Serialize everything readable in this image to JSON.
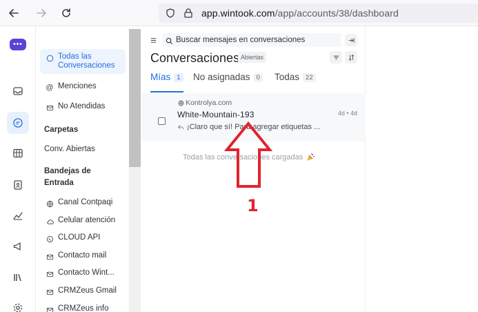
{
  "browser": {
    "url_domain": "app.wintook.com",
    "url_path": "/app/accounts/38/dashboard"
  },
  "rail": {
    "logo_glyph": "•••",
    "icons": [
      "inbox-icon",
      "chat-icon",
      "contacts-icon",
      "address-book-icon",
      "reports-icon",
      "campaigns-icon",
      "library-icon",
      "settings-icon"
    ]
  },
  "sidebar": {
    "items": [
      {
        "label": "Todas las Conversaciones",
        "icon": "chat-icon",
        "active": true
      },
      {
        "label": "Menciones",
        "icon": "at-icon"
      },
      {
        "label": "No Atendidas",
        "icon": "mail-icon"
      }
    ],
    "folders_heading": "Carpetas",
    "folders": [
      {
        "label": "Conv. Abiertas"
      }
    ],
    "inboxes_heading": "Bandejas de Entrada",
    "inboxes": [
      {
        "label": "Canal Contpaqi",
        "icon": "globe-icon"
      },
      {
        "label": "Celular atención",
        "icon": "cloud-icon"
      },
      {
        "label": "CLOUD API",
        "icon": "whatsapp-icon"
      },
      {
        "label": "Contacto mail",
        "icon": "mail-icon"
      },
      {
        "label": "Contacto Wint...",
        "icon": "mail-icon"
      },
      {
        "label": "CRMZeus Gmail",
        "icon": "mail-icon"
      },
      {
        "label": "CRMZeus info",
        "icon": "mail-icon"
      }
    ]
  },
  "main": {
    "search_placeholder": "Buscar mensajes en conversaciones",
    "title": "Conversaciones",
    "status": "Abiertas",
    "tabs": [
      {
        "label": "Mías",
        "count": "1",
        "active": true
      },
      {
        "label": "No asignadas",
        "count": "0"
      },
      {
        "label": "Todas",
        "count": "22"
      }
    ],
    "conversation": {
      "inbox": "Kontrolya.com",
      "contact": "White-Mountain-193",
      "preview": "¡Claro que sí! Para agregar etiquetas ...",
      "time": "4d • 4d"
    },
    "loaded_text": "Todas las conversaciones cargadas"
  },
  "annotation": {
    "number": "1",
    "color": "#e0242e"
  },
  "colors": {
    "accent": "#1f6fdb",
    "brand": "#5b43d6"
  }
}
